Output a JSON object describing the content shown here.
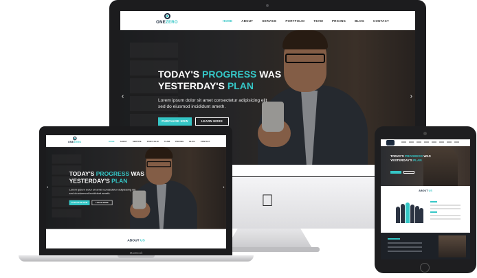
{
  "site": {
    "logo": {
      "first": "ONE",
      "second": "ZERO"
    },
    "menu": [
      "HOME",
      "ABOUT",
      "SERVICE",
      "PORTFOLIO",
      "TEAM",
      "PRICING",
      "BLOG",
      "CONTACT"
    ],
    "active_menu": "HOME",
    "hero": {
      "title_line1_a": "TODAY'S ",
      "title_line1_hl": "PROGRESS",
      "title_line1_b": " WAS",
      "title_line2_a": "YESTERDAY'S ",
      "title_line2_hl": "PLAN",
      "text": "Lorem ipsum dolor sit amet consectetur adipisicing elit sed do eiusmod incididunt ameth.",
      "primary_button": "PURCHASE NOW",
      "secondary_button": "LEARN MORE"
    },
    "about": {
      "a": "ABOUT ",
      "hl": "US"
    }
  },
  "laptop": {
    "label": "MacBook"
  },
  "icons": {
    "apple": "apple-logo-icon",
    "prev": "chevron-left-icon",
    "next": "chevron-right-icon"
  },
  "colors": {
    "accent": "#35c6c6",
    "navy": "#1b2a3d"
  }
}
